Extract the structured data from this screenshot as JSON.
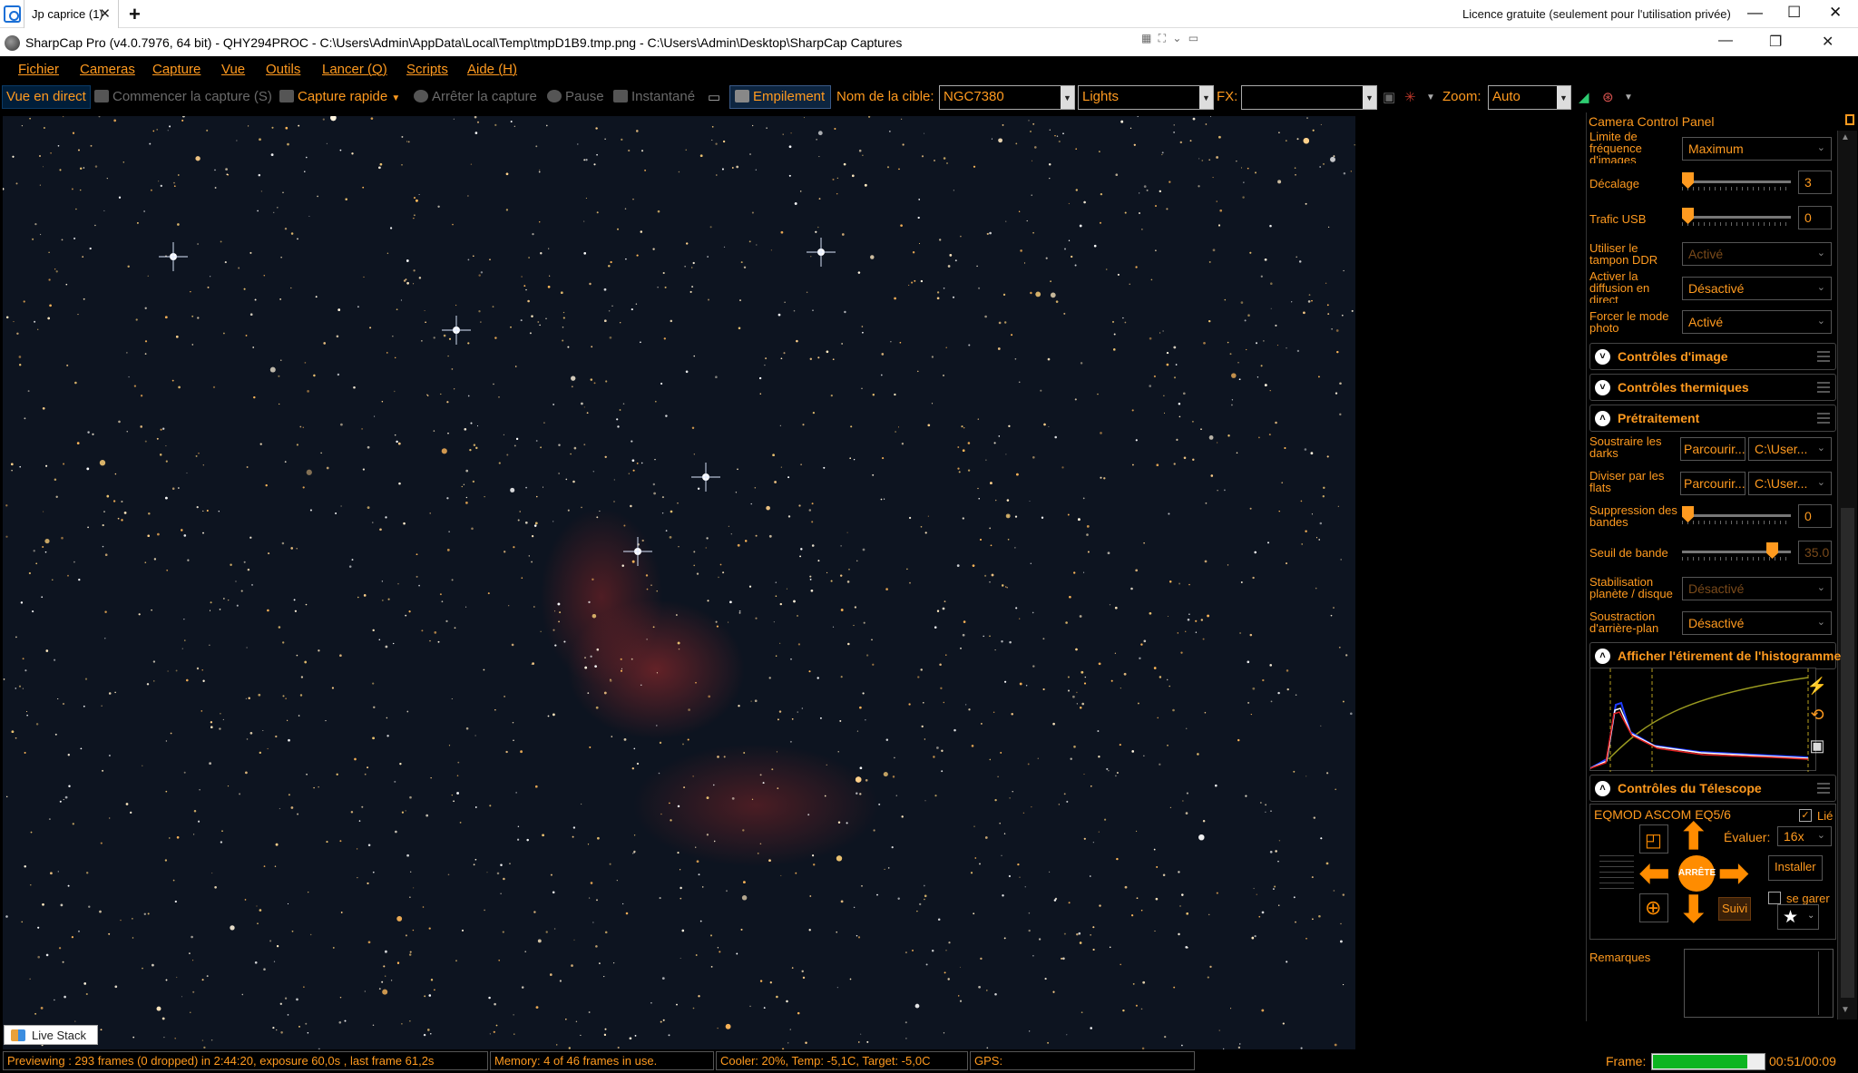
{
  "remote": {
    "tab_label": "Jp caprice (1)",
    "license": "Licence gratuite (seulement pour l'utilisation privée)"
  },
  "app": {
    "title": "SharpCap Pro (v4.0.7976, 64 bit) - QHY294PROC - C:\\Users\\Admin\\AppData\\Local\\Temp\\tmpD1B9.tmp.png - C:\\Users\\Admin\\Desktop\\SharpCap Captures"
  },
  "menu": [
    "Fichier",
    "Cameras",
    "Capture",
    "Vue",
    "Outils",
    "Lancer (Q)",
    "Scripts",
    "Aide (H)"
  ],
  "toolbar": {
    "live_view": "Vue en direct",
    "start_capture": "Commencer la capture (S)",
    "quick_capture": "Capture rapide",
    "stop_capture": "Arrêter la capture",
    "pause": "Pause",
    "snapshot": "Instantané",
    "stacking": "Empilement",
    "target_label": "Nom de la cible:",
    "target_value": "NGC7380",
    "frame_type": "Lights",
    "fx_label": "FX:",
    "fx_value": "",
    "zoom_label": "Zoom:",
    "zoom_value": "Auto"
  },
  "panel": {
    "header": "Camera Control Panel",
    "rows": {
      "frame_rate_limit": {
        "label": "Limite de fréquence d'images",
        "value": "Maximum"
      },
      "offset": {
        "label": "Décalage",
        "value": "3",
        "level": 0.0
      },
      "usb_traffic": {
        "label": "Trafic USB",
        "value": "0",
        "level": 0.0
      },
      "ddr_buffer": {
        "label": "Utiliser le tampon DDR",
        "value": "Activé"
      },
      "live_stream": {
        "label": "Activer la diffusion en direct",
        "value": "Désactivé"
      },
      "photo_mode": {
        "label": "Forcer le mode photo",
        "value": "Activé"
      }
    },
    "sections": {
      "image_controls": "Contrôles d'image",
      "thermal_controls": "Contrôles thermiques",
      "preprocessing": "Prétraitement",
      "histogram": "Afficher l'étirement de l'histogramme",
      "telescope": "Contrôles du Télescope"
    },
    "pre": {
      "darks_label": "Soustraire les darks",
      "flats_label": "Diviser par les flats",
      "browse": "Parcourir...",
      "path": "C:\\User...",
      "banding_label": "Suppression des bandes",
      "banding_value": "0",
      "banding_level": 0.0,
      "threshold_label": "Seuil de bande",
      "threshold_value": "35.0",
      "threshold_level": 0.87,
      "stabilization_label": "Stabilisation planète / disque",
      "stabilization_value": "Désactivé",
      "background_label": "Soustraction d'arrière-plan",
      "background_value": "Désactivé"
    },
    "scope": {
      "mount": "EQMOD ASCOM EQ5/6",
      "linked": "Lié",
      "rate_label": "Évaluer:",
      "rate_value": "16x",
      "install": "Installer",
      "park": "se garer",
      "stop": "ARRÊTE",
      "track": "Suivi"
    },
    "remarks_label": "Remarques"
  },
  "bottom": {
    "tab": "Live Stack"
  },
  "status": {
    "preview": "Previewing : 293 frames (0 dropped) in 2:44:20, exposure 60,0s , last frame 61,2s",
    "memory": "Memory: 4 of 46 frames in use.",
    "cooler": "Cooler: 20%, Temp: -5,1C, Target: -5,0C",
    "gps": "GPS:",
    "frame_label": "Frame:",
    "frame_progress": 0.85,
    "frame_time": "00:51/00:09"
  }
}
